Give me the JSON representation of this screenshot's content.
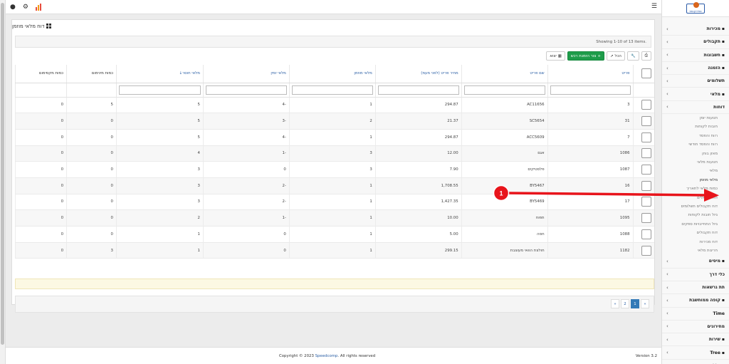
{
  "topbar": {
    "user_icon": "user-icon",
    "settings_icon": "cogs-icon",
    "chart_icon": "bar-chart-icon",
    "menu_icon": "hamburger-icon",
    "chart_colors": [
      "#e74c3c",
      "#f39c12",
      "#e74c3c"
    ]
  },
  "logo": {
    "text": "ספידקומפ"
  },
  "sidebar": {
    "items": [
      {
        "label": "מכירות",
        "icon": "thumbs-up-icon"
      },
      {
        "label": "תקבולים",
        "icon": "thumbs-up-icon"
      },
      {
        "label": "חשבונות",
        "icon": "folder-icon"
      },
      {
        "label": "הזמנה",
        "icon": "cart-icon"
      },
      {
        "label": "תשלומים",
        "icon": ""
      },
      {
        "label": "מלאי",
        "icon": "tag-icon"
      },
      {
        "label": "דוחות",
        "icon": ""
      }
    ],
    "sub_items": [
      "תנועות יומן",
      "חובות לקוחות",
      "רווח והפסד",
      "רווח והפסד חודשי",
      "מאזן בוחן",
      "תנועות מלאי",
      "מלאי",
      "מלאי מוזמן",
      "כמות מלאי לתאריך",
      "דוח סריאלים",
      "דוח תקבולים תשלומים",
      "גיול חובות לקוחות",
      "גיול התחייבויות ספקים",
      "דוח תקבולים",
      "דוח מכירות",
      "חריגות מלאי"
    ],
    "bottom_items": [
      {
        "label": "מיסים",
        "icon": "flag-icon"
      },
      {
        "label": "כלי דרך",
        "icon": ""
      },
      {
        "label": "תת גרשאות",
        "icon": ""
      },
      {
        "label": "קופה ממוחשבת",
        "icon": "cart-icon"
      },
      {
        "label": "Time",
        "icon": ""
      },
      {
        "label": "מחירונים",
        "icon": ""
      },
      {
        "label": "שירות",
        "icon": "wrench-icon"
      },
      {
        "label": "Tree",
        "icon": "sitemap-icon"
      },
      {
        "label": "כללי",
        "icon": "tools-icon"
      }
    ]
  },
  "panel": {
    "title": "דוח מלאי מוזמן",
    "showing": "Showing 1-10 of 13 items.",
    "toolbar": {
      "print": "print-icon",
      "wrench": "wrench-icon",
      "all_label": "הכל",
      "add_label": "צור הזמנת רכש",
      "export_label": "יצוא"
    },
    "columns": [
      "פריט",
      "שם פריט",
      "מחיר פריט (לפני מעמ)",
      "מלאי מוזמן",
      "מלאי זמין",
      "מלאי חוסר",
      "כמות מינימום",
      "כמות מקסימום"
    ],
    "rows": [
      [
        "3",
        "AC11656",
        "294.87",
        "1",
        "-4",
        "5",
        "5",
        "0"
      ],
      [
        "31",
        "SC5654",
        "21.37",
        "2",
        "-3",
        "5",
        "0",
        "0"
      ],
      [
        "7",
        "ACC5609",
        "294.87",
        "1",
        "-4",
        "5",
        "0",
        "0"
      ],
      [
        "1086",
        "אגם",
        "12.00",
        "3",
        "-1",
        "4",
        "0",
        "0"
      ],
      [
        "1087",
        "פלסטיקים",
        "7.90",
        "3",
        "0",
        "3",
        "0",
        "0"
      ],
      [
        "16",
        "BY5467",
        "1,708.55",
        "1",
        "-2",
        "3",
        "0",
        "0"
      ],
      [
        "17",
        "BY5469",
        "1,427.35",
        "1",
        "-2",
        "3",
        "0",
        "0"
      ],
      [
        "1095",
        "תפוח",
        "10.00",
        "1",
        "-1",
        "2",
        "0",
        "0"
      ],
      [
        "1088",
        "חסה",
        "5.00",
        "1",
        "0",
        "1",
        "0",
        "0"
      ],
      [
        "1182",
        "חולצת הוואי מעוצבת",
        "299.15",
        "1",
        "0",
        "1",
        "3",
        "0"
      ]
    ],
    "pagination": [
      "»",
      "1",
      "2",
      "«"
    ]
  },
  "footer": {
    "copy_prefix": "Copyright © 2023 ",
    "brand": "Speedcomp",
    "copy_suffix": ". All rights reserved",
    "version": "Version 3.2"
  },
  "annotation": {
    "badge": "1",
    "color": "#e8141b"
  }
}
